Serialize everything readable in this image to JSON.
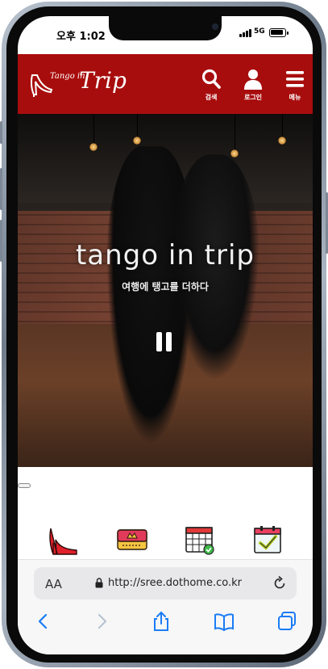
{
  "status": {
    "time": "오후 1:02",
    "network": "5G"
  },
  "header": {
    "logo_small": "Tango in",
    "logo_big": "Trip",
    "background_color": "#a80d0d",
    "nav": [
      {
        "label": "검색",
        "icon": "search-icon"
      },
      {
        "label": "로그인",
        "icon": "user-icon"
      },
      {
        "label": "메뉴",
        "icon": "menu-icon"
      }
    ]
  },
  "hero": {
    "title": "tango in trip",
    "subtitle": "여행에 탱고를 더하다",
    "control": "pause-icon"
  },
  "quick_icons": [
    {
      "icon": "high-heel-icon"
    },
    {
      "icon": "ticket-icon"
    },
    {
      "icon": "calendar-check-icon"
    },
    {
      "icon": "calendar-approve-icon"
    }
  ],
  "browser": {
    "aa_label": "AA",
    "url": "http://sree.dothome.co.kr",
    "accent_color": "#1a7cf5"
  }
}
